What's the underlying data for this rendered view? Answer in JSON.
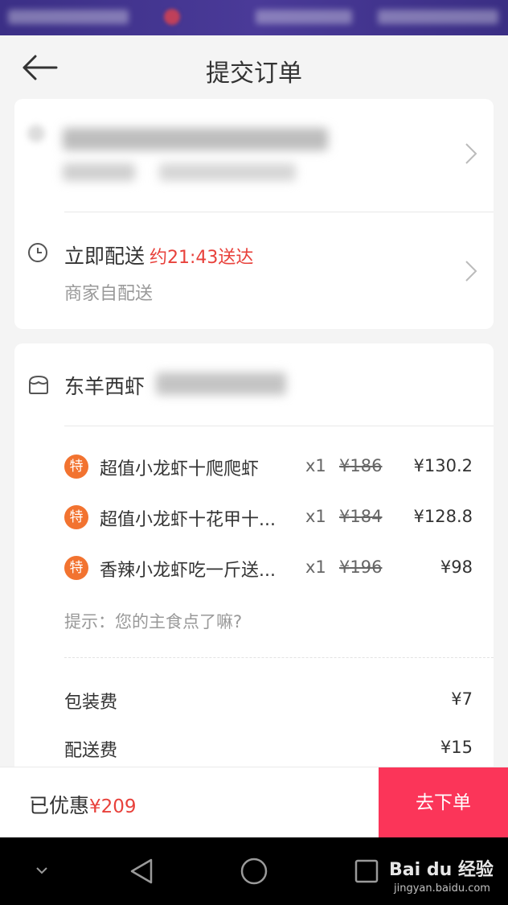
{
  "header": {
    "title": "提交订单"
  },
  "delivery": {
    "label": "立即配送",
    "eta": "约21:43送达",
    "sub": "商家自配送"
  },
  "shop": {
    "name": "东羊西虾"
  },
  "items": [
    {
      "badge": "特",
      "name": "超值小龙虾十爬爬虾",
      "qty": "x1",
      "orig": "¥186",
      "price": "¥130.2"
    },
    {
      "badge": "特",
      "name": "超值小龙虾十花甲十...",
      "qty": "x1",
      "orig": "¥184",
      "price": "¥128.8"
    },
    {
      "badge": "特",
      "name": "香辣小龙虾吃一斤送...",
      "qty": "x1",
      "orig": "¥196",
      "price": "¥98"
    }
  ],
  "hint": "提示：您的主食点了嘛?",
  "fees": [
    {
      "label": "包装费",
      "value": "¥7"
    },
    {
      "label": "配送费",
      "value": "¥15"
    }
  ],
  "footer": {
    "saved_label": "已优惠",
    "saved_value": "¥209",
    "submit": "去下单"
  },
  "watermark": {
    "brand": "Bai du 经验",
    "url": "jingyan.baidu.com"
  },
  "colors": {
    "accent_red": "#e8413b",
    "submit_bg": "#fb3559",
    "badge_orange": "#f27330"
  },
  "icons": [
    "back-arrow-icon",
    "chevron-right-icon",
    "clock-icon",
    "shop-icon",
    "back-nav-icon",
    "home-nav-icon",
    "recents-nav-icon",
    "dropdown-nav-icon"
  ]
}
